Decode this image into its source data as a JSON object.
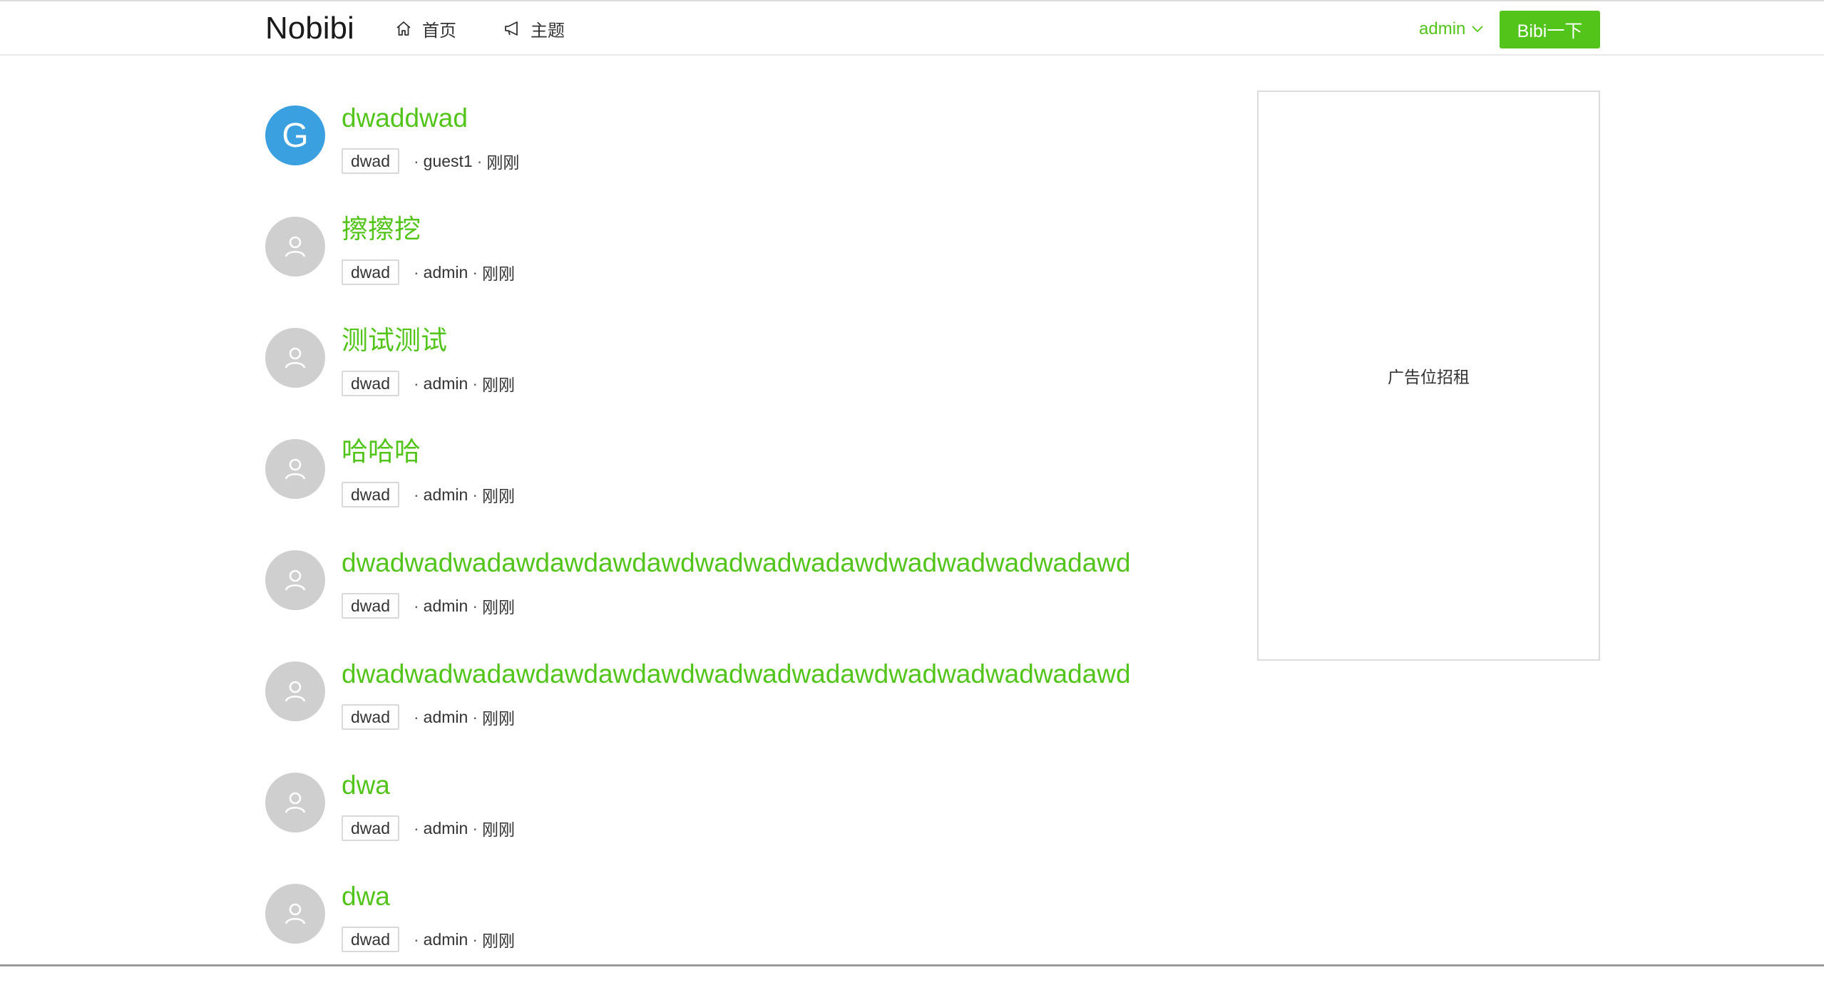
{
  "header": {
    "brand": "Nobibi",
    "nav": [
      {
        "label": "首页",
        "icon": "home-icon"
      },
      {
        "label": "主题",
        "icon": "megaphone-icon"
      }
    ],
    "user": "admin",
    "action_label": "Bibi一下"
  },
  "colors": {
    "accent": "#52c41a",
    "avatar_letter_bg": "#3aa0df",
    "avatar_default_bg": "#cfcfcf"
  },
  "posts": [
    {
      "title": "dwaddwad",
      "tag": "dwad",
      "author": "guest1",
      "time": "刚刚",
      "avatar_letter": "G"
    },
    {
      "title": "擦擦挖",
      "tag": "dwad",
      "author": "admin",
      "time": "刚刚",
      "avatar_letter": ""
    },
    {
      "title": "测试测试",
      "tag": "dwad",
      "author": "admin",
      "time": "刚刚",
      "avatar_letter": ""
    },
    {
      "title": "哈哈哈",
      "tag": "dwad",
      "author": "admin",
      "time": "刚刚",
      "avatar_letter": ""
    },
    {
      "title": "dwadwadwadawdawdawdawdwadwadwadawdwadwadwadwadawd",
      "tag": "dwad",
      "author": "admin",
      "time": "刚刚",
      "avatar_letter": ""
    },
    {
      "title": "dwadwadwadawdawdawdawdwadwadwadawdwadwadwadwadawd",
      "tag": "dwad",
      "author": "admin",
      "time": "刚刚",
      "avatar_letter": ""
    },
    {
      "title": "dwa",
      "tag": "dwad",
      "author": "admin",
      "time": "刚刚",
      "avatar_letter": ""
    },
    {
      "title": "dwa",
      "tag": "dwad",
      "author": "admin",
      "time": "刚刚",
      "avatar_letter": ""
    }
  ],
  "sidebar": {
    "ad_text": "广告位招租"
  },
  "meta_separator": "·"
}
